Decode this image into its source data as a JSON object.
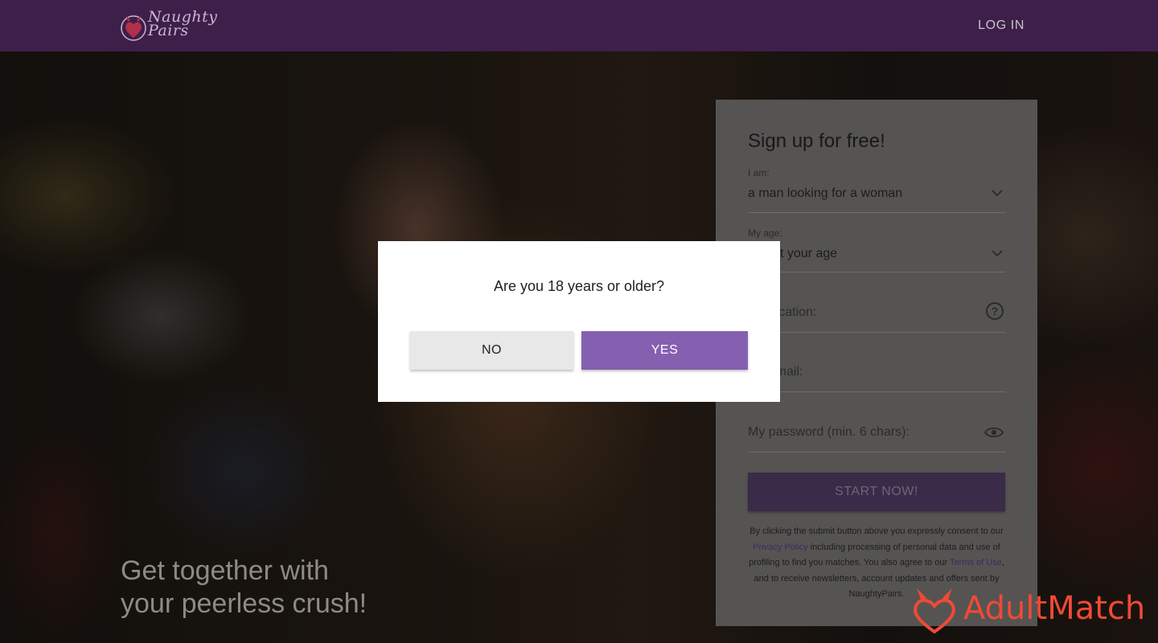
{
  "header": {
    "logo_text": "Naughty Pairs",
    "login_label": "LOG IN"
  },
  "hero": {
    "tagline_line1": "Get together with",
    "tagline_line2": "your peerless crush!"
  },
  "signup": {
    "title": "Sign up for free!",
    "iam_label": "I am:",
    "iam_value": "a man looking for a woman",
    "age_label": "My age:",
    "age_value": "Select your age",
    "location_placeholder": "My location:",
    "email_placeholder": "My email:",
    "password_placeholder": "My password (min. 6 chars):",
    "submit_label": "START NOW!",
    "legal_part1": "By clicking the submit button above you expressly consent to our ",
    "privacy_link": "Privacy Policy",
    "legal_part2": " including processing of personal data and use of profiling to find you matches. You also agree to our ",
    "terms_link": "Terms of Use",
    "legal_part3": ", and to receive newsletters, account updates and offers sent by NaughtyPairs."
  },
  "modal": {
    "question": "Are you 18 years or older?",
    "no_label": "NO",
    "yes_label": "YES"
  },
  "watermark": {
    "text": "AdultMatch"
  },
  "icons": {
    "logo": "devil-heart-icon",
    "select": "chevron-down-icon",
    "location_help": "question-circle-icon",
    "password_toggle": "eye-icon",
    "watermark": "devil-heart-icon"
  },
  "colors": {
    "header_bg": "#3e1f4a",
    "accent": "#8560b0",
    "watermark": "#f04a35"
  }
}
